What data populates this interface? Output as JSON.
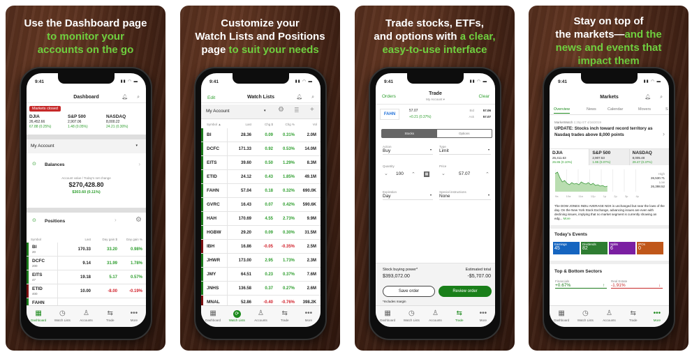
{
  "panels": [
    {
      "headline": [
        [
          {
            "t": "Use the Dashboard page",
            "c": "w"
          }
        ],
        [
          {
            "t": "to monitor your",
            "c": "g"
          }
        ],
        [
          {
            "t": "accounts on the go",
            "c": "g"
          }
        ]
      ]
    },
    {
      "headline": [
        [
          {
            "t": "Customize your",
            "c": "w"
          }
        ],
        [
          {
            "t": "Watch Lists and Positions",
            "c": "w"
          }
        ],
        [
          {
            "t": "page",
            "c": "w"
          },
          {
            "t": " to suit your needs",
            "c": "g"
          }
        ]
      ]
    },
    {
      "headline": [
        [
          {
            "t": "Trade stocks, ETFs,",
            "c": "w"
          }
        ],
        [
          {
            "t": "and options with",
            "c": "w"
          },
          {
            "t": " a clear,",
            "c": "g"
          }
        ],
        [
          {
            "t": "easy-to-use interface",
            "c": "g"
          }
        ]
      ]
    },
    {
      "headline": [
        [
          {
            "t": "Stay on top of",
            "c": "w"
          }
        ],
        [
          {
            "t": "the markets—",
            "c": "w"
          },
          {
            "t": "and the",
            "c": "g"
          }
        ],
        [
          {
            "t": "news and events that",
            "c": "g"
          }
        ],
        [
          {
            "t": "impact them",
            "c": "g"
          }
        ]
      ]
    }
  ],
  "status_time": "9:41",
  "tabbar": [
    {
      "label": "Dashboard",
      "icon": "dashboard-icon",
      "glyph": "▦"
    },
    {
      "label": "Watch Lists",
      "icon": "watch-lists-icon",
      "glyph": "◷"
    },
    {
      "label": "Accounts",
      "icon": "accounts-icon",
      "glyph": "♙"
    },
    {
      "label": "Trade",
      "icon": "trade-icon",
      "glyph": "⇆"
    },
    {
      "label": "More",
      "icon": "more-icon",
      "glyph": "•••"
    }
  ],
  "colors": {
    "green": "#2e9e2e",
    "red": "#d0202a",
    "headline_green": "#6fcf3f",
    "button_green": "#1a7f1a"
  },
  "dashboard": {
    "title": "Dashboard",
    "markets_badge": "Markets closed",
    "indices": [
      {
        "name": "DJIA",
        "value": "26,452.66",
        "change": "67.88 (0.25%)"
      },
      {
        "name": "S&P 500",
        "value": "2,907.06",
        "change": "1.48 (0.05%)"
      },
      {
        "name": "NASDAQ",
        "value": "8,000.22",
        "change": "24.21 (0.30%)"
      }
    ],
    "account": "My Account",
    "balances": "Balances",
    "account_value_label": "Account value / Today's net change",
    "account_value": "$270,428.80",
    "net_change": "$303.60 (0.11%)",
    "positions": "Positions",
    "columns": [
      "Symbol",
      "Last",
      "Day gain $",
      "Day gain %"
    ],
    "rows": [
      {
        "symbol": "BI",
        "qty": "20",
        "last": "170.33",
        "gain": "33.20",
        "pct": "0.98%",
        "dir": "up"
      },
      {
        "symbol": "DCFC",
        "qty": "200",
        "last": "9.14",
        "gain": "31.99",
        "pct": "1.78%",
        "dir": "up"
      },
      {
        "symbol": "EITS",
        "qty": "47",
        "last": "19.18",
        "gain": "5.17",
        "pct": "0.57%",
        "dir": "up"
      },
      {
        "symbol": "ETID",
        "qty": "400",
        "last": "10.00",
        "gain": "-8.00",
        "pct": "-0.19%",
        "dir": "down"
      },
      {
        "symbol": "FAHN",
        "qty": "",
        "last": "",
        "gain": "",
        "pct": "",
        "dir": "up"
      }
    ]
  },
  "watchlists": {
    "edit": "Edit",
    "title": "Watch Lists",
    "account": "My Account",
    "columns": [
      "Symbol ▲",
      "Last",
      "Chg $",
      "Chg %",
      "Vol"
    ],
    "rows": [
      {
        "symbol": "BI",
        "last": "28.36",
        "chg": "0.09",
        "pct": "0.31%",
        "vol": "2.0M",
        "dir": "up"
      },
      {
        "symbol": "DCFC",
        "last": "171.33",
        "chg": "0.92",
        "pct": "0.53%",
        "vol": "14.0M",
        "dir": "up"
      },
      {
        "symbol": "EITS",
        "last": "39.60",
        "chg": "0.50",
        "pct": "1.29%",
        "vol": "8.3M",
        "dir": "up"
      },
      {
        "symbol": "ETID",
        "last": "24.12",
        "chg": "0.43",
        "pct": "1.85%",
        "vol": "49.1M",
        "dir": "up"
      },
      {
        "symbol": "FAHN",
        "last": "57.04",
        "chg": "0.18",
        "pct": "0.32%",
        "vol": "690.0K",
        "dir": "up"
      },
      {
        "symbol": "GVRC",
        "last": "16.43",
        "chg": "0.07",
        "pct": "0.42%",
        "vol": "590.6K",
        "dir": "up"
      },
      {
        "symbol": "HAH",
        "last": "170.69",
        "chg": "4.55",
        "pct": "2.73%",
        "vol": "9.9M",
        "dir": "up"
      },
      {
        "symbol": "HGBW",
        "last": "29.20",
        "chg": "0.09",
        "pct": "0.30%",
        "vol": "31.5M",
        "dir": "up"
      },
      {
        "symbol": "IBH",
        "last": "16.86",
        "chg": "-0.05",
        "pct": "-0.35%",
        "vol": "2.5M",
        "dir": "down"
      },
      {
        "symbol": "JHWR",
        "last": "173.00",
        "chg": "2.95",
        "pct": "1.73%",
        "vol": "2.3M",
        "dir": "up"
      },
      {
        "symbol": "JMY",
        "last": "64.51",
        "chg": "0.23",
        "pct": "0.37%",
        "vol": "7.6M",
        "dir": "up"
      },
      {
        "symbol": "JNHS",
        "last": "136.58",
        "chg": "0.37",
        "pct": "0.27%",
        "vol": "2.6M",
        "dir": "up"
      },
      {
        "symbol": "MNAL",
        "last": "52.86",
        "chg": "-0.40",
        "pct": "-0.76%",
        "vol": "398.2K",
        "dir": "down"
      }
    ]
  },
  "trade": {
    "orders": "Orders",
    "title": "Trade",
    "account": "My Account ▾",
    "clear": "Clear",
    "symbol": "FAHN",
    "price": "57.07",
    "change": "+0.21 (0.37%)",
    "bid_label": "Bid",
    "bid": "57.06",
    "ask_label": "Ask",
    "ask": "57.07",
    "seg": [
      "Stocks",
      "Options"
    ],
    "action_label": "Action",
    "action": "Buy",
    "type_label": "Type",
    "type": "Limit",
    "quantity_label": "Quantity",
    "quantity": "100",
    "price_label": "Price",
    "limit_price": "57.07",
    "expiration_label": "Expiration",
    "expiration": "Day",
    "special_label": "Special instructions",
    "special": "None",
    "buying_power_label": "Stock buying power*",
    "buying_power": "$393,072.00",
    "est_total_label": "Estimated total",
    "est_total": "-$5,707.00",
    "save": "Save order",
    "review": "Review order",
    "margin_note": "*Includes margin"
  },
  "markets": {
    "title": "Markets",
    "tabs": [
      "Overview",
      "News",
      "Calendar",
      "Movers",
      "S"
    ],
    "source": "MarketWatch",
    "timestamp": "1:25p ET 4/16/2019",
    "headline": "UPDATE: Stocks inch toward record territory as Nasdaq trades above 8,000 points",
    "indices": [
      {
        "name": "DJIA",
        "value": "26,411.63",
        "change": "26.86 (0.10%)"
      },
      {
        "name": "S&P 500",
        "value": "2,907.53",
        "change": "1.95 (0.07%)"
      },
      {
        "name": "NASDAQ",
        "value": "8,005.48",
        "change": "29.47 (0.37%)"
      }
    ],
    "high_label": "High",
    "high": "26,530.71",
    "low_label": "Low",
    "low": "26,398.52",
    "times": [
      "9a",
      "10a",
      "11a",
      "12p",
      "1p",
      "2p",
      "3p",
      "4p"
    ],
    "summary": "The DOW JONES INDU AVERAGE NDX is unchanged but near the lows of the day. On the New York Stock Exchange, advancing issues are even with declining issues, implying that no market segment is currently showing an edg...",
    "more": "More",
    "events_title": "Today's Events",
    "events": [
      {
        "name": "Earnings",
        "count": "45",
        "color": "#1565c0"
      },
      {
        "name": "Dividends",
        "count": "82",
        "color": "#2e7d32"
      },
      {
        "name": "Splits",
        "count": "6",
        "color": "#7b1fa2"
      },
      {
        "name": "IPOs",
        "count": "0",
        "color": "#c0571a"
      }
    ],
    "sectors_title": "Top & Bottom Sectors",
    "sectors": [
      {
        "name": "Financials",
        "value": "+0.67%",
        "dir": "up"
      },
      {
        "name": "Real Estate",
        "value": "-1.91%",
        "dir": "down"
      }
    ]
  },
  "active_tabs": [
    "Dashboard",
    "Watch Lists",
    "Trade",
    "More"
  ]
}
